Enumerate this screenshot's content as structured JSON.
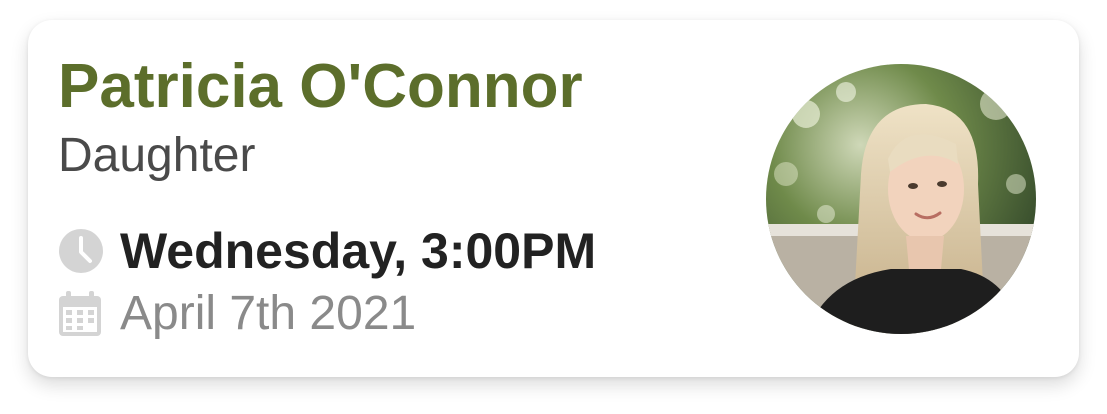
{
  "contact": {
    "name": "Patricia O'Connor",
    "relationship": "Daughter",
    "time": "Wednesday, 3:00PM",
    "date": "April 7th 2021"
  },
  "icons": {
    "time": "clock-icon",
    "date": "calendar-icon"
  },
  "colors": {
    "name": "#5c6e2b",
    "relationship": "#4a4a4a",
    "time": "#222222",
    "date": "#8a8a8a",
    "icon": "#d4d4d4"
  }
}
